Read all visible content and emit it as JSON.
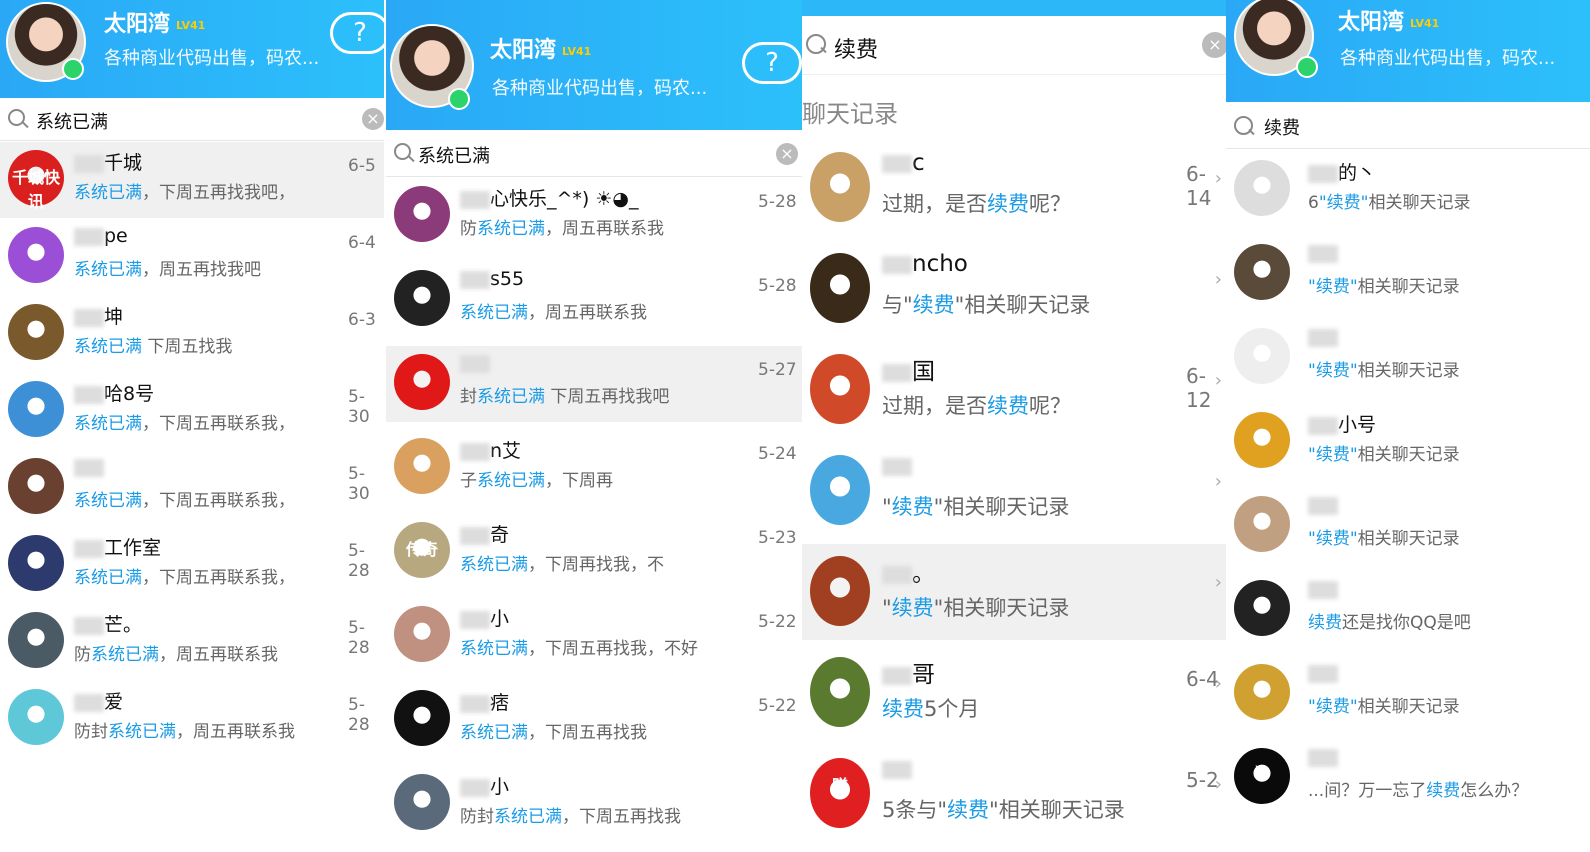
{
  "profile": {
    "name": "太阳湾",
    "level": "LV41",
    "signature": "各种商业代码出售，码农..."
  },
  "panels": [
    {
      "search_query": "系统已满",
      "items": [
        {
          "name": "千城",
          "msg_pre": "",
          "msg_hl": "系统已满",
          "msg_post": "，下周五再找我吧，",
          "time": "6-5",
          "avatar_color": "#d9201f",
          "avatar_text": "千城快讯"
        },
        {
          "name": "pe",
          "msg_pre": "",
          "msg_hl": "系统已满",
          "msg_post": "，周五再找我吧",
          "time": "6-4",
          "avatar_color": "#9b4fd6",
          "avatar_text": ""
        },
        {
          "name": "坤",
          "msg_pre": "",
          "msg_hl": "系统已满",
          "msg_post": " 下周五找我",
          "time": "6-3",
          "avatar_color": "#7a5a2c",
          "avatar_text": ""
        },
        {
          "name": "哈8号",
          "msg_pre": "",
          "msg_hl": "系统已满",
          "msg_post": "，下周五再联系我，",
          "time": "5-30",
          "avatar_color": "#3d8fd6",
          "avatar_text": "8"
        },
        {
          "name": "",
          "msg_pre": "",
          "msg_hl": "系统已满",
          "msg_post": "，下周五再联系我，",
          "time": "5-30",
          "avatar_color": "#6a4030",
          "avatar_text": ""
        },
        {
          "name": "工作室",
          "msg_pre": "",
          "msg_hl": "系统已满",
          "msg_post": "，下周五再联系我，",
          "time": "5-28",
          "avatar_color": "#2d3a6e",
          "avatar_text": ""
        },
        {
          "name": "芒。",
          "msg_pre": "防",
          "msg_hl": "系统已满",
          "msg_post": "，周五再联系我",
          "time": "5-28",
          "avatar_color": "#4a5b66",
          "avatar_text": ""
        },
        {
          "name": "爱",
          "msg_pre": "防封",
          "msg_hl": "系统已满",
          "msg_post": "，周五再联系我",
          "time": "5-28",
          "avatar_color": "#5ec8d8",
          "avatar_text": ""
        }
      ]
    },
    {
      "search_query": "系统已满",
      "items": [
        {
          "name": "心快乐_^*) ☀◕_",
          "msg_pre": "防",
          "msg_hl": "系统已满",
          "msg_post": "，周五再联系我",
          "time": "5-28",
          "avatar_color": "#8b3a7a",
          "avatar_text": ""
        },
        {
          "name": "s55",
          "msg_pre": "",
          "msg_hl": "系统已满",
          "msg_post": "，周五再联系我",
          "time": "5-28",
          "avatar_color": "#222222",
          "avatar_text": ""
        },
        {
          "name": "",
          "msg_pre": "封",
          "msg_hl": "系统已满",
          "msg_post": " 下周五再找我吧",
          "time": "5-27",
          "avatar_color": "#e01818",
          "avatar_text": ""
        },
        {
          "name": "n艾",
          "msg_pre": "子",
          "msg_hl": "系统已满",
          "msg_post": "，下周再",
          "time": "5-24",
          "avatar_color": "#d9a060",
          "avatar_text": ""
        },
        {
          "name": "奇",
          "msg_pre": "",
          "msg_hl": "系统已满",
          "msg_post": "，下周再找我，不",
          "time": "5-23",
          "avatar_color": "#b8a880",
          "avatar_text": "传奇"
        },
        {
          "name": "小",
          "msg_pre": "",
          "msg_hl": "系统已满",
          "msg_post": "，下周五再找我，不好",
          "time": "5-22",
          "avatar_color": "#c09080",
          "avatar_text": ""
        },
        {
          "name": "痞",
          "msg_pre": "",
          "msg_hl": "系统已满",
          "msg_post": "，下周五再找我",
          "time": "5-22",
          "avatar_color": "#111111",
          "avatar_text": ""
        },
        {
          "name": "小",
          "msg_pre": "防封",
          "msg_hl": "系统已满",
          "msg_post": "，下周五再找我",
          "time": "",
          "avatar_color": "#5a6a7a",
          "avatar_text": ""
        }
      ]
    },
    {
      "search_query": "续费",
      "section_label": "聊天记录",
      "items": [
        {
          "name": "c",
          "msg_pre": "过期，是否",
          "msg_hl": "续费",
          "msg_post": "呢？",
          "time": "6-14",
          "avatar_color": "#c9a066",
          "avatar_text": ""
        },
        {
          "name": "ncho",
          "msg_pre": "与\"",
          "msg_hl": "续费",
          "msg_post": "\"相关聊天记录",
          "time": "",
          "avatar_color": "#3a2a1a",
          "avatar_text": ""
        },
        {
          "name": "国",
          "msg_pre": "过期，是否",
          "msg_hl": "续费",
          "msg_post": "呢？",
          "time": "6-12",
          "avatar_color": "#d04a2a",
          "avatar_text": ""
        },
        {
          "name": "",
          "msg_pre": "\"",
          "msg_hl": "续费",
          "msg_post": "\"相关聊天记录",
          "time": "",
          "avatar_color": "#4aa8e0",
          "avatar_text": ""
        },
        {
          "name": "。",
          "msg_pre": "\"",
          "msg_hl": "续费",
          "msg_post": "\"相关聊天记录",
          "time": "",
          "avatar_color": "#a04020",
          "avatar_text": ""
        },
        {
          "name": "哥",
          "msg_pre": "",
          "msg_hl": "续费",
          "msg_post": "5个月",
          "time": "6-4",
          "avatar_color": "#5a7a30",
          "avatar_text": ""
        },
        {
          "name": "",
          "msg_pre": "5条与\"",
          "msg_hl": "续费",
          "msg_post": "\"相关聊天记录",
          "time": "5-2",
          "avatar_color": "#e02020",
          "avatar_text": "赚"
        }
      ]
    },
    {
      "search_query": "续费",
      "items": [
        {
          "name": "的丶",
          "msg_pre": "6",
          "msg_hl": "\"续费\"",
          "msg_post": "相关聊天记录",
          "time": "",
          "avatar_color": "#dddddd",
          "avatar_text": ""
        },
        {
          "name": "",
          "msg_pre": "",
          "msg_hl": "\"续费\"",
          "msg_post": "相关聊天记录",
          "time": "",
          "avatar_color": "#5a4a3a",
          "avatar_text": ""
        },
        {
          "name": "",
          "msg_pre": "",
          "msg_hl": "\"续费\"",
          "msg_post": "相关聊天记录",
          "time": "",
          "avatar_color": "#eeeeee",
          "avatar_text": ""
        },
        {
          "name": "小号",
          "msg_pre": "",
          "msg_hl": "\"续费\"",
          "msg_post": "相关聊天记录",
          "time": "",
          "avatar_color": "#e0a020",
          "avatar_text": ""
        },
        {
          "name": "",
          "msg_pre": "",
          "msg_hl": "\"续费\"",
          "msg_post": "相关聊天记录",
          "time": "",
          "avatar_color": "#c0a080",
          "avatar_text": ""
        },
        {
          "name": "",
          "msg_pre": "",
          "msg_hl": "续费",
          "msg_post": "还是找你QQ是吧",
          "time": "",
          "avatar_color": "#222222",
          "avatar_text": ""
        },
        {
          "name": "",
          "msg_pre": "",
          "msg_hl": "\"续费\"",
          "msg_post": "相关聊天记录",
          "time": "",
          "avatar_color": "#d0a030",
          "avatar_text": ""
        },
        {
          "name": "",
          "msg_pre": "...间？万一忘了",
          "msg_hl": "续费",
          "msg_post": "怎么办？",
          "time": "",
          "avatar_color": "#0a0a0a",
          "avatar_text": "♏"
        }
      ]
    }
  ]
}
